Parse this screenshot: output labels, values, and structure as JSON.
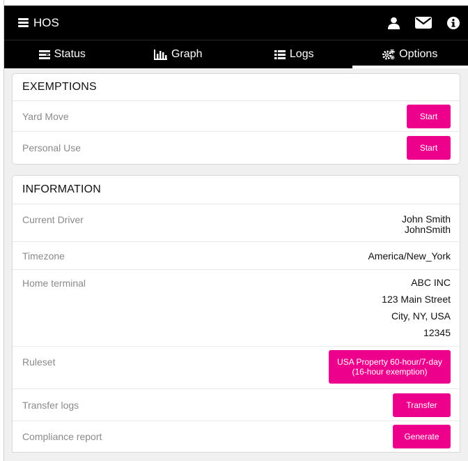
{
  "header": {
    "title": "HOS"
  },
  "tabs": [
    {
      "label": "Status"
    },
    {
      "label": "Graph"
    },
    {
      "label": "Logs"
    },
    {
      "label": "Options"
    }
  ],
  "exemptions": {
    "title": "EXEMPTIONS",
    "items": [
      {
        "label": "Yard Move",
        "button": "Start"
      },
      {
        "label": "Personal Use",
        "button": "Start"
      }
    ]
  },
  "information": {
    "title": "INFORMATION",
    "current_driver": {
      "label": "Current Driver",
      "name": "John Smith",
      "username": "JohnSmith"
    },
    "timezone": {
      "label": "Timezone",
      "value": "America/New_York"
    },
    "home_terminal": {
      "label": "Home terminal",
      "line1": "ABC INC",
      "line2": "123 Main Street",
      "line3": "City, NY, USA",
      "line4": "12345"
    },
    "ruleset": {
      "label": "Ruleset",
      "button": "USA Property 60-hour/7-day (16-hour exemption)"
    },
    "transfer": {
      "label": "Transfer logs",
      "button": "Transfer"
    },
    "compliance": {
      "label": "Compliance report",
      "button": "Generate"
    }
  },
  "colors": {
    "accent": "#ec008c",
    "bar": "#000000",
    "background": "#f0f0f0"
  }
}
